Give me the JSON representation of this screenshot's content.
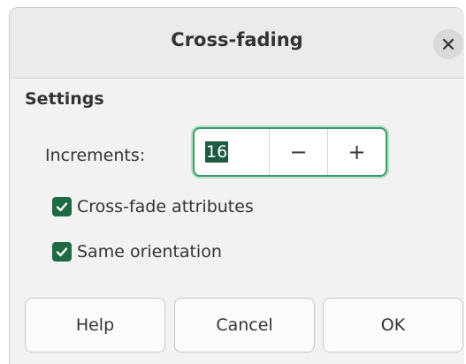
{
  "dialog": {
    "title": "Cross-fading"
  },
  "settings": {
    "heading": "Settings",
    "increments": {
      "label": "Increments:",
      "value": "16",
      "decrement_symbol": "−",
      "increment_symbol": "+"
    },
    "options": [
      {
        "label": "Cross-fade attributes",
        "checked": true
      },
      {
        "label": "Same orientation",
        "checked": true
      }
    ]
  },
  "buttons": {
    "help": "Help",
    "cancel": "Cancel",
    "ok": "OK"
  },
  "colors": {
    "accent": "#1e6b43",
    "focus_ring": "#3a9a6a"
  }
}
